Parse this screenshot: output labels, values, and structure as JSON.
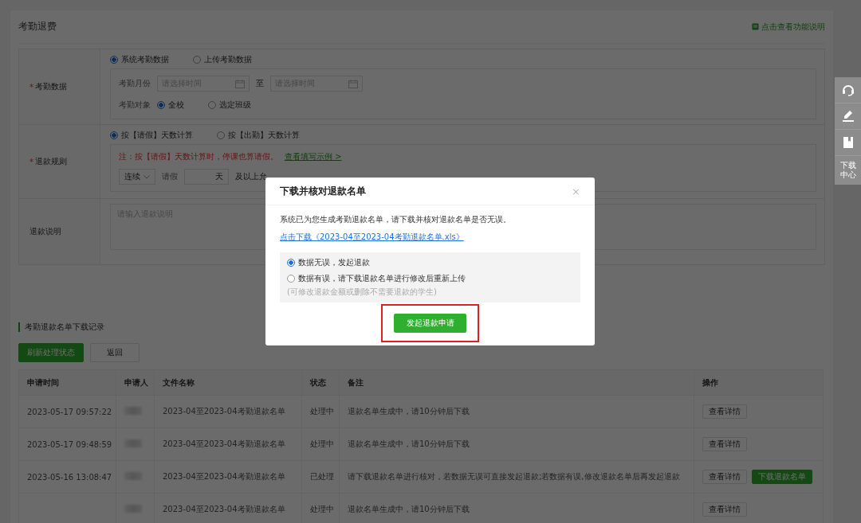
{
  "page": {
    "title": "考勤退费",
    "help_link": "点击查看功能说明"
  },
  "form": {
    "attendance": {
      "marker": "*",
      "label": "考勤数据",
      "sources": [
        {
          "label": "系统考勤数据",
          "selected": true
        },
        {
          "label": "上传考勤数据",
          "selected": false
        }
      ],
      "month_label": "考勤月份",
      "start_placeholder": "请选择时间",
      "to": "至",
      "end_placeholder": "请选择时间",
      "target_label": "考勤对象",
      "targets": [
        {
          "label": "全校",
          "selected": true
        },
        {
          "label": "选定班级",
          "selected": false
        }
      ]
    },
    "rule": {
      "marker": "*",
      "label": "退款规则",
      "methods": [
        {
          "label": "按【请假】天数计算",
          "selected": true
        },
        {
          "label": "按【出勤】天数计算",
          "selected": false
        }
      ],
      "note": "注：按【请假】天数计算时，停课也算请假。",
      "example_link": "查看填写示例 >",
      "mode": "连续",
      "leave_label": "请假",
      "day_unit": "天",
      "suffix": "及以上允"
    },
    "description": {
      "label": "退款说明",
      "placeholder": "请输入退款说明"
    }
  },
  "side_tools": [
    {
      "kind": "support"
    },
    {
      "kind": "edit"
    },
    {
      "kind": "book"
    },
    {
      "kind": "text",
      "label": "下载中心"
    }
  ],
  "records": {
    "title": "考勤退款名单下载记录",
    "buttons": [
      {
        "label": "刷新处理状态",
        "kind": "primary"
      },
      {
        "label": "返回",
        "kind": "secondary"
      }
    ],
    "columns": [
      "申请时间",
      "申请人",
      "文件名称",
      "状态",
      "备注",
      "操作"
    ],
    "rows": [
      {
        "time": "2023-05-17 09:57:22",
        "file": "2023-04至2023-04考勤退款名单",
        "status": "处理中",
        "note": "退款名单生成中，请10分钟后下载",
        "actions": [
          {
            "label": "查看详情",
            "kind": "secondary"
          }
        ]
      },
      {
        "time": "2023-05-17 09:48:59",
        "file": "2023-04至2023-04考勤退款名单",
        "status": "处理中",
        "note": "退款名单生成中，请10分钟后下载",
        "actions": [
          {
            "label": "查看详情",
            "kind": "secondary"
          }
        ]
      },
      {
        "time": "2023-05-16 13:08:47",
        "file": "2023-04至2023-04考勤退款名单",
        "status": "已处理",
        "note": "请下载退款名单进行核对，若数据无误可直接发起退款;若数据有误,修改退款名单后再发起退款",
        "actions": [
          {
            "label": "查看详情",
            "kind": "secondary"
          },
          {
            "label": "下载退款名单",
            "kind": "primary"
          }
        ]
      },
      {
        "file": "2023-04至2023-04考勤退款名单",
        "status": "处理中",
        "note": "退款名单生成中，请10分钟后下载",
        "actions": [
          {
            "label": "查看详情",
            "kind": "secondary"
          }
        ]
      }
    ]
  },
  "dialog": {
    "title": "下载并核对退款名单",
    "close": "×",
    "message": "系统已为您生成考勤退款名单，请下载并核对退款名单是否无误。",
    "download_link": "点击下载《2023-04至2023-04考勤退款名单.xls》",
    "options": [
      {
        "label": "数据无误，发起退款",
        "selected": true
      },
      {
        "label": "数据有误，请下载退款名单进行修改后重新上传",
        "hint": "(可修改退款金额或删除不需要退款的学生)",
        "selected": false
      }
    ],
    "submit": "发起退款申请",
    "highlighted": true
  }
}
